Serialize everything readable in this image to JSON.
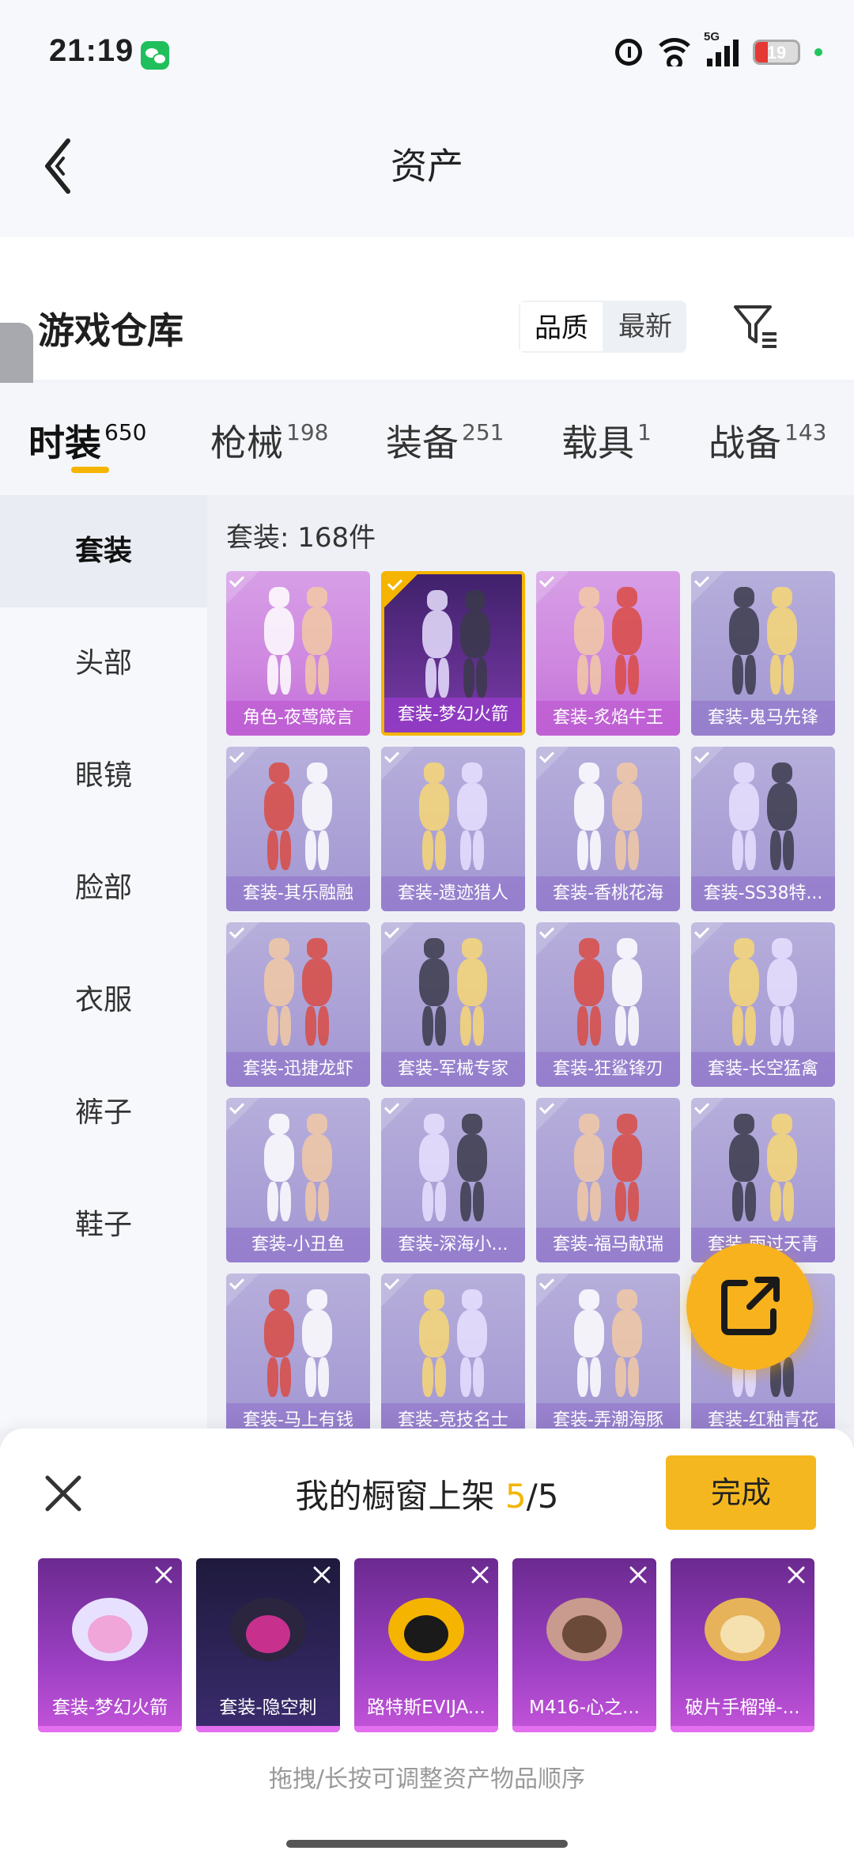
{
  "status_bar": {
    "time": "21:19",
    "network": "5G",
    "battery": "19"
  },
  "header": {
    "title": "资产"
  },
  "warehouse": {
    "title": "游戏仓库",
    "sort_options": [
      "品质",
      "最新"
    ],
    "selected_sort": "品质"
  },
  "category_tabs": [
    {
      "label": "时装",
      "count": "650",
      "active": true
    },
    {
      "label": "枪械",
      "count": "198",
      "active": false
    },
    {
      "label": "装备",
      "count": "251",
      "active": false
    },
    {
      "label": "载具",
      "count": "1",
      "active": false
    },
    {
      "label": "战备",
      "count": "143",
      "active": false
    }
  ],
  "sidebar": {
    "items": [
      {
        "label": "套装",
        "active": true
      },
      {
        "label": "头部"
      },
      {
        "label": "眼镜"
      },
      {
        "label": "脸部"
      },
      {
        "label": "衣服"
      },
      {
        "label": "裤子"
      },
      {
        "label": "鞋子"
      }
    ]
  },
  "grid": {
    "count_label": "套装: 168件",
    "items": [
      {
        "label": "角色-夜莺箴言",
        "style": "pink"
      },
      {
        "label": "套装-梦幻火箭",
        "style": "selected"
      },
      {
        "label": "套装-炙焰牛王",
        "style": "pink"
      },
      {
        "label": "套装-鬼马先锋",
        "style": "normal"
      },
      {
        "label": "套装-其乐融融",
        "style": "normal"
      },
      {
        "label": "套装-遗迹猎人",
        "style": "normal"
      },
      {
        "label": "套装-香桃花海",
        "style": "normal"
      },
      {
        "label": "套装-SS38特...",
        "style": "normal"
      },
      {
        "label": "套装-迅捷龙虾",
        "style": "normal"
      },
      {
        "label": "套装-军械专家",
        "style": "normal"
      },
      {
        "label": "套装-狂鲨锋刃",
        "style": "normal"
      },
      {
        "label": "套装-长空猛禽",
        "style": "normal"
      },
      {
        "label": "套装-小丑鱼",
        "style": "normal"
      },
      {
        "label": "套装-深海小...",
        "style": "normal"
      },
      {
        "label": "套装-福马献瑞",
        "style": "normal"
      },
      {
        "label": "套装-雨过天青",
        "style": "normal"
      },
      {
        "label": "套装-马上有钱",
        "style": "normal"
      },
      {
        "label": "套装-竞技名士",
        "style": "normal"
      },
      {
        "label": "套装-弄潮海豚",
        "style": "normal"
      },
      {
        "label": "套装-红釉青花",
        "style": "normal"
      }
    ]
  },
  "showcase": {
    "title_prefix": "我的橱窗上架",
    "current": "5",
    "total": "/5",
    "done_label": "完成",
    "items": [
      {
        "label": "套装-梦幻火箭",
        "style": "purple"
      },
      {
        "label": "套装-隐空刺",
        "style": "dark"
      },
      {
        "label": "路特斯EVIJA...",
        "style": "purple"
      },
      {
        "label": "M416-心之...",
        "style": "purple"
      },
      {
        "label": "破片手榴弹-...",
        "style": "purple"
      }
    ],
    "hint": "拖拽/长按可调整资产物品顺序"
  },
  "colors": {
    "accent": "#f5b400",
    "done_button": "#f5b71f",
    "fab": "#f7b21e",
    "card_purple": "#a296d2",
    "card_pink": "#cf88e0"
  }
}
